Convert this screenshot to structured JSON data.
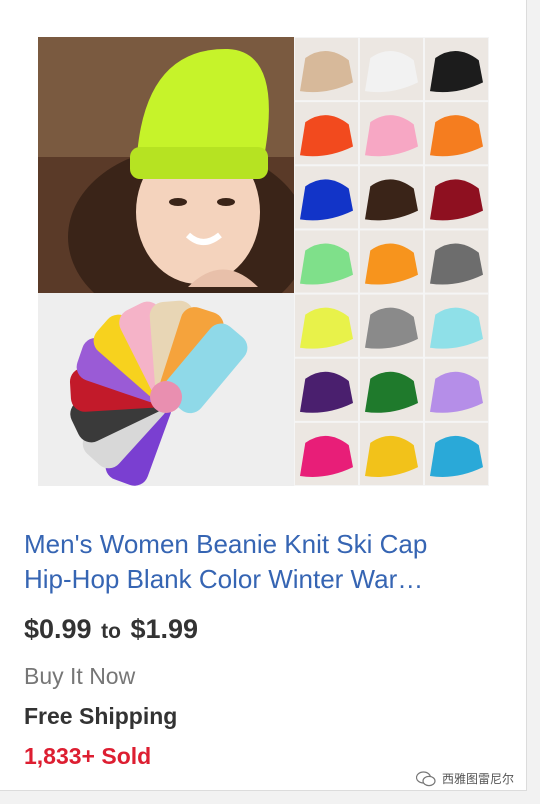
{
  "listing": {
    "title_line1": "Men's Women Beanie Knit Ski Cap",
    "title_line2": "Hip-Hop Blank Color Winter War…",
    "price_low": "$0.99",
    "price_sep": "to",
    "price_high": "$1.99",
    "buy_format": "Buy It Now",
    "shipping": "Free Shipping",
    "sold": "1,833+ Sold"
  },
  "image": {
    "swatch_colors": [
      "#d7b99a",
      "#f2f2f2",
      "#1c1c1c",
      "#f24a1e",
      "#f7a7c4",
      "#f57d1f",
      "#1234c8",
      "#3a2418",
      "#8e1020",
      "#7fe08a",
      "#f7941d",
      "#6d6d6d",
      "#e8f24a",
      "#8a8a8a",
      "#8fe0e8",
      "#4a1f6e",
      "#1f7a2c",
      "#b58ee8",
      "#e81e78",
      "#f2c21a",
      "#2aa9d8"
    ],
    "pile_colors": [
      "#7a3fd1",
      "#d8d8d8",
      "#3a3a3a",
      "#c21a2a",
      "#9a5bd6",
      "#f7d21e",
      "#f5b3c8",
      "#e8d6b5",
      "#f5a33c",
      "#8fd9e8"
    ]
  },
  "watermark": {
    "text": "西雅图雷尼尔",
    "icon": "wechat-icon"
  }
}
